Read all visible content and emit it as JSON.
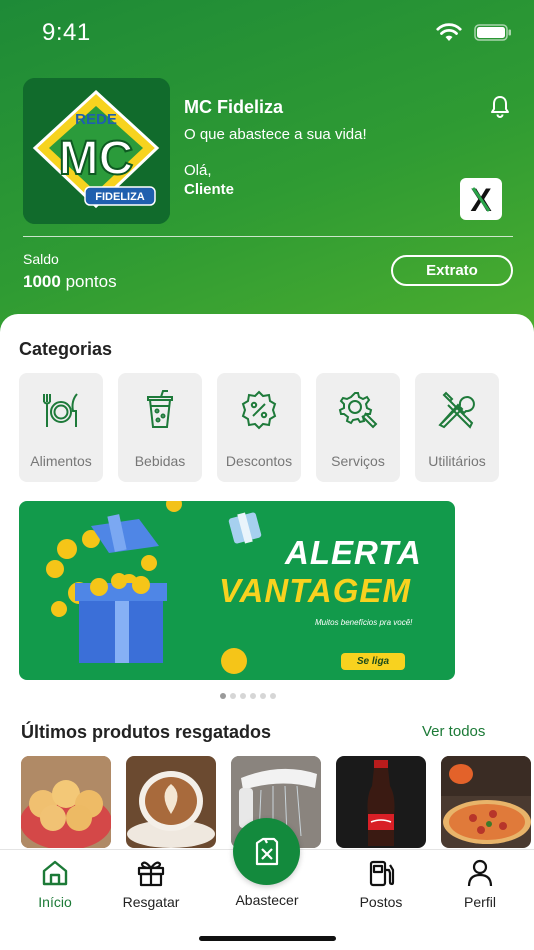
{
  "status_bar": {
    "time": "9:41",
    "wifi_icon": "wifi-icon",
    "battery_icon": "battery-icon"
  },
  "header": {
    "logo": {
      "top_text": "REDE",
      "main_text": "MC",
      "badge_text": "FIDELIZA"
    },
    "brand_name": "MC Fideliza",
    "tagline": "O que abastece a sua vida!",
    "greeting": "Olá,",
    "user_name": "Cliente",
    "notification_icon": "bell-icon",
    "partner_logo_text": "X"
  },
  "balance": {
    "label": "Saldo",
    "value": "1000",
    "unit": "pontos",
    "button_label": "Extrato"
  },
  "categories": {
    "title": "Categorias",
    "items": [
      {
        "label": "Alimentos",
        "icon": "plate-cutlery-icon"
      },
      {
        "label": "Bebidas",
        "icon": "drink-cup-icon"
      },
      {
        "label": "Descontos",
        "icon": "discount-badge-icon"
      },
      {
        "label": "Serviços",
        "icon": "gear-wrench-icon"
      },
      {
        "label": "Utilitários",
        "icon": "tools-icon"
      }
    ]
  },
  "banner": {
    "title_line1": "ALERTA",
    "title_line2": "VANTAGEM",
    "subtitle": "Muitos benefícios pra você!",
    "cta": "Se liga",
    "slide_count": 6,
    "active_slide": 1
  },
  "recent_products": {
    "title": "Últimos produtos resgatados",
    "see_all": "Ver todos",
    "items": [
      {
        "image": "cheese-bread-image"
      },
      {
        "image": "cappuccino-image"
      },
      {
        "image": "shower-head-image"
      },
      {
        "image": "cola-bottle-image"
      },
      {
        "image": "pizza-image"
      }
    ]
  },
  "tab_bar": {
    "items": [
      {
        "label": "Início",
        "icon": "home-icon",
        "active": true
      },
      {
        "label": "Resgatar",
        "icon": "gift-icon",
        "active": false
      },
      {
        "label": "Abastecer",
        "icon": "fuel-can-icon",
        "active": false
      },
      {
        "label": "Postos",
        "icon": "gas-station-icon",
        "active": false
      },
      {
        "label": "Perfil",
        "icon": "user-icon",
        "active": false
      }
    ]
  },
  "colors": {
    "primary": "#1c7a37",
    "header_gradient_end": "#4cae2f",
    "banner": "#129a4b",
    "banner_accent": "#f8d21f"
  }
}
